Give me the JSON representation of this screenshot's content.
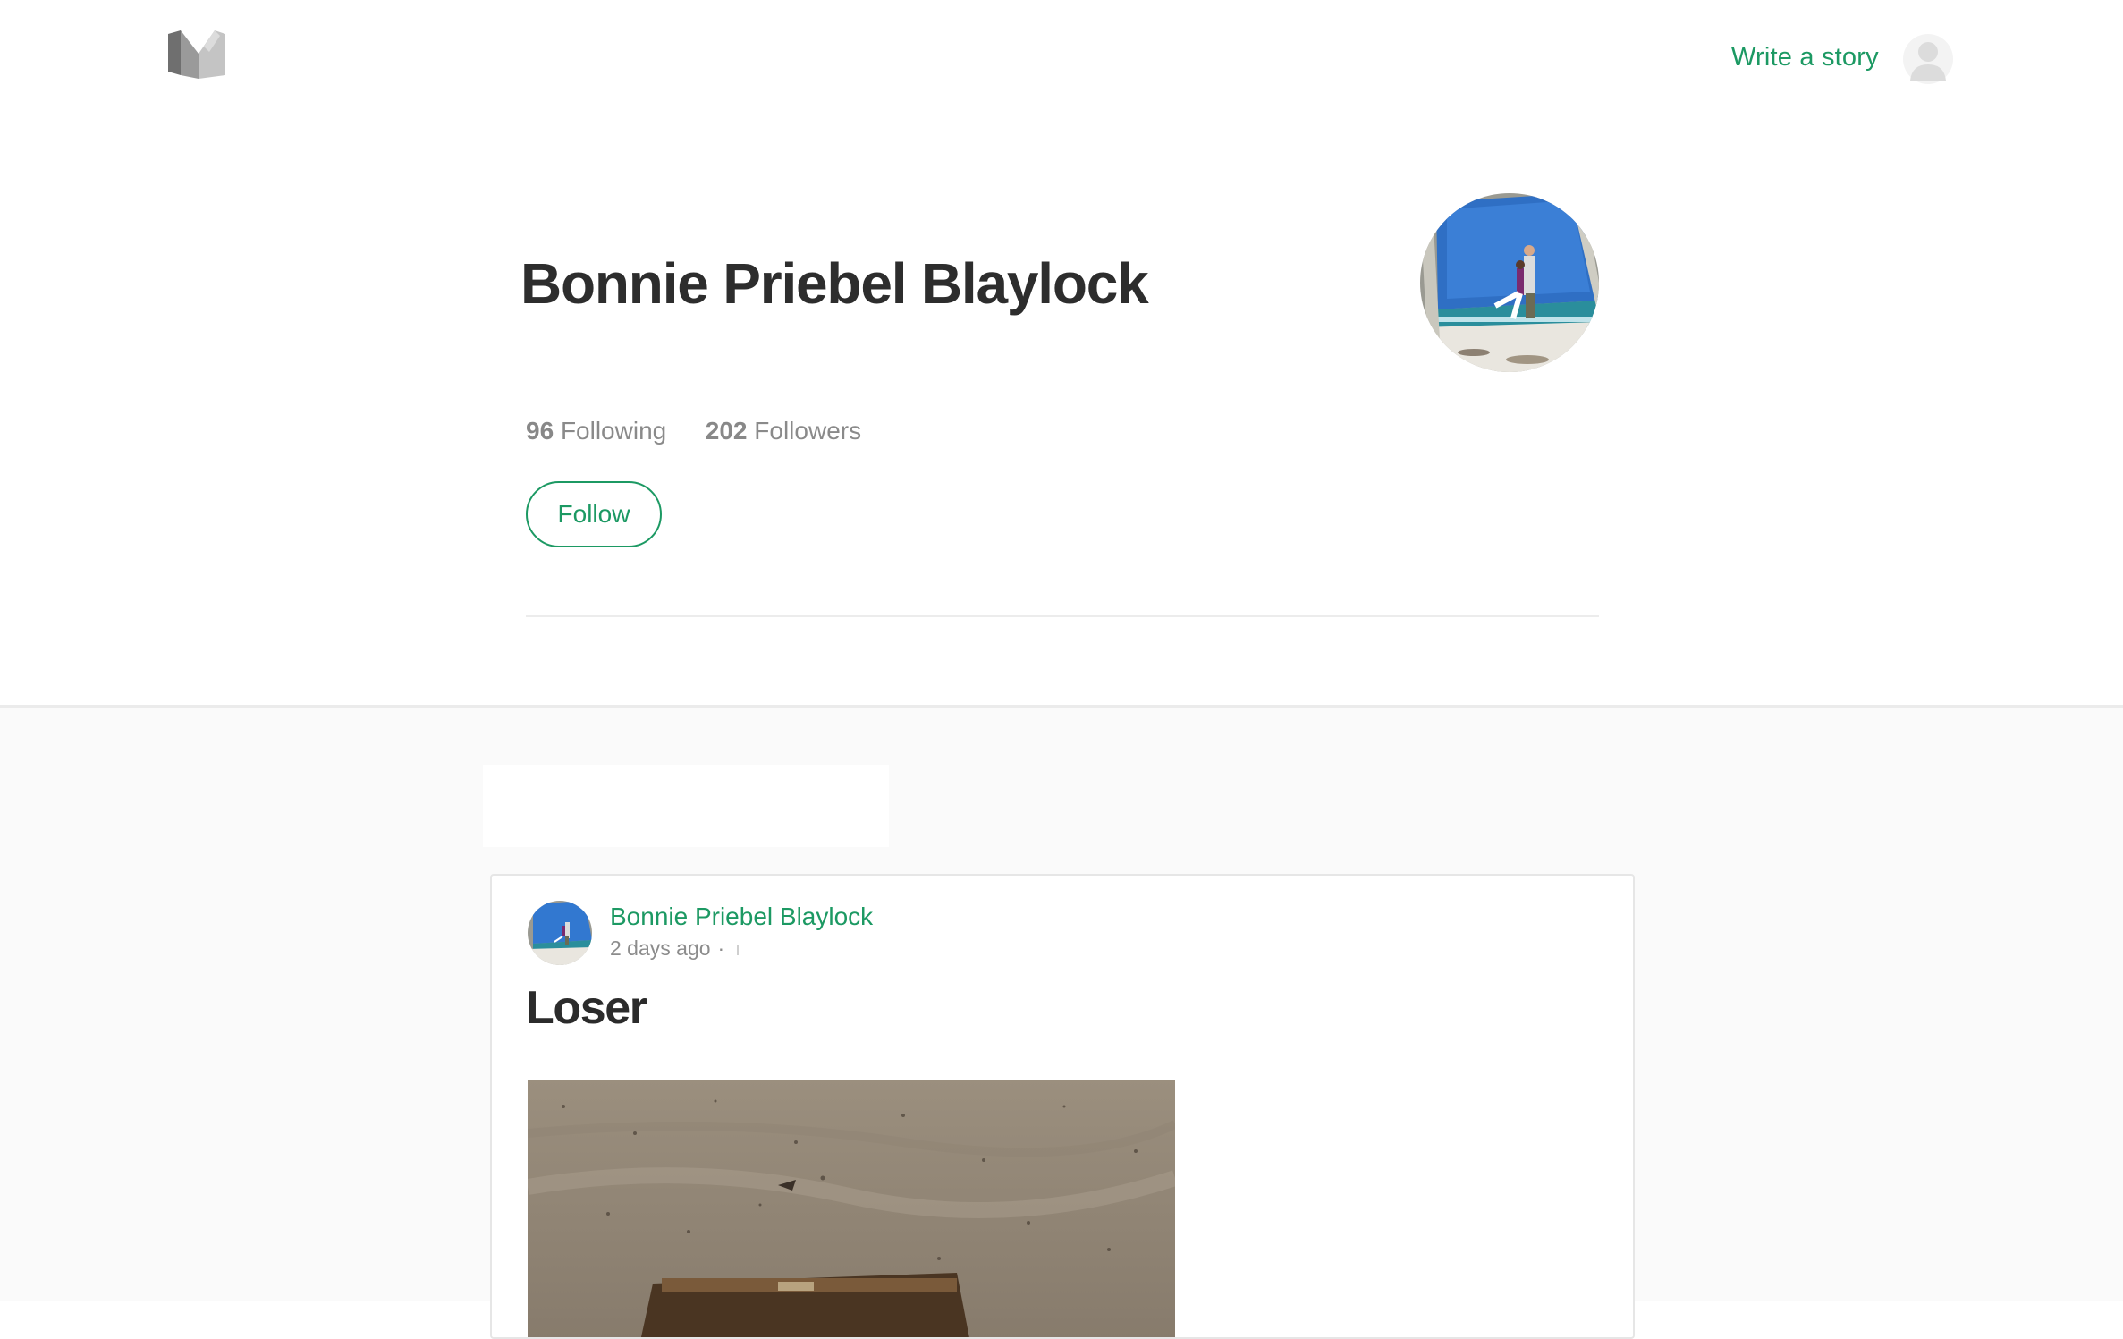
{
  "nav": {
    "logo_name": "medium-logo",
    "write_label": "Write a story",
    "avatar_icon": "user-placeholder-icon"
  },
  "profile": {
    "name": "Bonnie Priebel Blaylock",
    "following_count": "96",
    "following_label": "Following",
    "followers_count": "202",
    "followers_label": "Followers",
    "follow_label": "Follow"
  },
  "stream": {
    "posts": [
      {
        "author": "Bonnie Priebel Blaylock",
        "time": "2 days ago",
        "separator": "·",
        "title": "Loser"
      }
    ]
  },
  "colors": {
    "accent": "#1c9963",
    "name_text": "#2d2d2d",
    "muted_text": "#8a8a8a",
    "stream_bg": "#fafafa"
  }
}
